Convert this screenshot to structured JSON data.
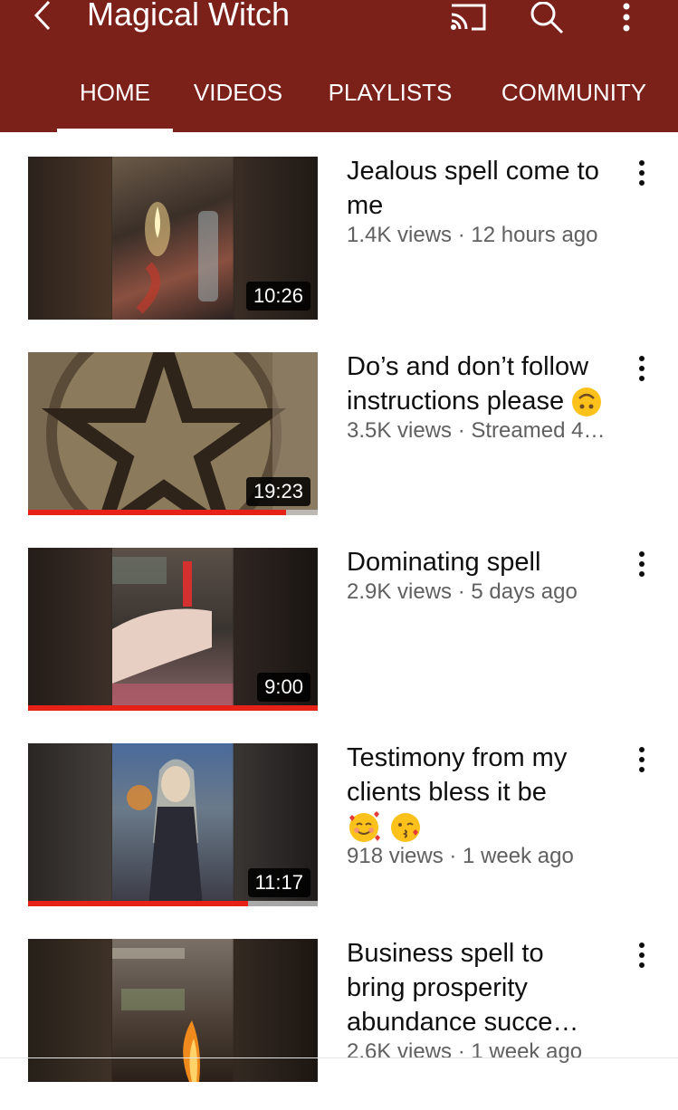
{
  "header": {
    "title": "Magical Witch",
    "background": "#7c201a",
    "icons": [
      "back-arrow-icon",
      "cast-icon",
      "search-icon",
      "more-vert-icon"
    ]
  },
  "tabs": [
    {
      "label": "HOME",
      "active": true
    },
    {
      "label": "VIDEOS",
      "active": false
    },
    {
      "label": "PLAYLISTS",
      "active": false
    },
    {
      "label": "COMMUNITY",
      "active": false
    }
  ],
  "videos": [
    {
      "title": "Jealous spell come to me",
      "meta": "1.4K views · 12 hours ago",
      "duration": "10:26",
      "watched_fraction": 0
    },
    {
      "title": "Do’s and don’t follow instructions please",
      "emoji": "upside-down-face",
      "meta": "3.5K views · Streamed 4…",
      "duration": "19:23",
      "watched_fraction": 0.89
    },
    {
      "title": "Dominating spell",
      "meta": "2.9K views · 5 days ago",
      "duration": "9:00",
      "watched_fraction": 1.0
    },
    {
      "title": "Testimony from my clients bless it be",
      "emoji": "smiling-face-with-hearts kissing-face",
      "meta": "918 views · 1 week ago",
      "duration": "11:17",
      "watched_fraction": 0.76
    },
    {
      "title": "Business spell to bring prosperity abundance succe…",
      "meta": "2.6K views · 1 week ago",
      "duration": "",
      "watched_fraction": 0
    }
  ],
  "colors": {
    "accent": "#7c201a",
    "progress": "#e62117",
    "meta_text": "#606060"
  }
}
